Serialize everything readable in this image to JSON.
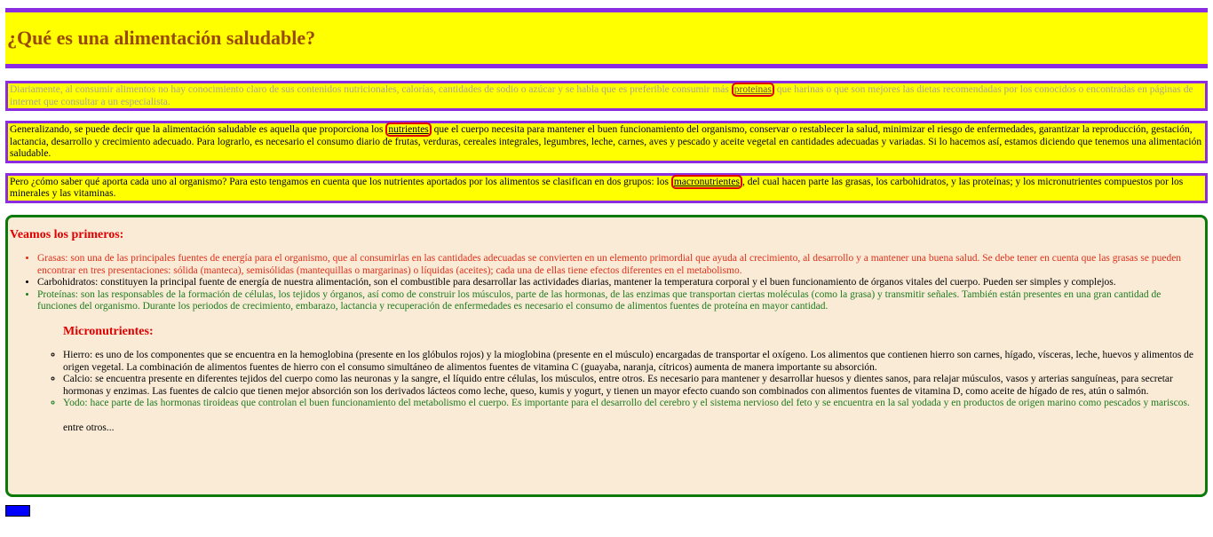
{
  "header": {
    "title": "¿Qué es una alimentación saludable?"
  },
  "paragraphs": {
    "p1": {
      "before": "Diariamente, al consumir alimentos no hay conocimiento claro de sus contenidos nutricionales, calorías, cantidades de sodio o azúcar y se habla que es preferible consumir más ",
      "link": "proteinas",
      "after": " que harinas o que son mejores las dietas recomendadas por los conocidos o encontradas en páginas de internet que consultar a un especialista."
    },
    "p2": {
      "before": "Generalizando, se puede decir que la alimentación saludable es aquella que proporciona los ",
      "link": "nutrientes",
      "after": " que el cuerpo necesita para mantener el buen funcionamiento del organismo, conservar o restablecer la salud, minimizar el riesgo de enfermedades, garantizar la reproducción, gestación, lactancia, desarrollo y crecimiento adecuado. Para lograrlo, es necesario el consumo diario de frutas, verduras, cereales integrales, legumbres, leche, carnes, aves y pescado y aceite vegetal en cantidades adecuadas y variadas. Si lo hacemos así, estamos diciendo que tenemos una alimentación saludable."
    },
    "p3": {
      "before": "Pero ¿cómo saber qué aporta cada uno al organismo? Para esto tengamos en cuenta que los nutrientes aportados por los alimentos se clasifican en dos grupos: los ",
      "link": "macronutrientes",
      "after": ", del cual hacen parte las grasas, los carbohidratos, y las proteínas; y los micronutrientes compuestos por los minerales y las vitaminas."
    }
  },
  "box": {
    "heading": "Veamos los primeros:",
    "macros": [
      "Grasas: son una de las principales fuentes de energía para el organismo, que al consumirlas en las cantidades adecuadas se convierten en un elemento primordial que ayuda al crecimiento, al desarrollo y a mantener una buena salud. Se debe tener en cuenta que las grasas se pueden encontrar en tres presentaciones: sólida (manteca), semisólidas (mantequillas o margarinas) o líquidas (aceites); cada una de ellas tiene efectos diferentes en el metabolismo.",
      "Carbohidratos: constituyen la principal fuente de energía de nuestra alimentación, son el combustible para desarrollar las actividades diarias, mantener la temperatura corporal y el buen funcionamiento de órganos vitales del cuerpo. Pueden ser simples y complejos.",
      "Proteínas: son las responsables de la formación de células, los tejidos y órganos, así como de construir los músculos, parte de las hormonas, de las enzimas que transportan ciertas moléculas (como la grasa) y transmitir señales. También están presentes en una gran cantidad de funciones del organismo. Durante los periodos de crecimiento, embarazo, lactancia y recuperación de enfermedades es necesario el consumo de alimentos fuentes de proteína en mayor cantidad."
    ],
    "micro_heading": "Micronutrientes:",
    "micros": [
      "Hierro: es uno de los componentes que se encuentra en la hemoglobina (presente en los glóbulos rojos) y la mioglobina (presente en el músculo) encargadas de transportar el oxígeno. Los alimentos que contienen hierro son carnes, hígado, vísceras, leche, huevos y alimentos de origen vegetal. La combinación de alimentos fuentes de hierro con el consumo simultáneo de alimentos fuentes de vitamina C (guayaba, naranja, cítricos) aumenta de manera importante su absorción.",
      "Calcio: se encuentra presente en diferentes tejidos del cuerpo como las neuronas y la sangre, el líquido entre células, los músculos, entre otros. Es necesario para mantener y desarrollar huesos y dientes sanos, para relajar músculos, vasos y arterias sanguíneas, para secretar hormonas y enzimas. Las fuentes de calcio que tienen mejor absorción son los derivados lácteos como leche, queso, kumis y yogurt, y tienen un mayor efecto cuando son combinados con alimentos fuentes de vitamina D, como aceite de hígado de res, atún o salmón.",
      "Yodo: hace parte de las hormonas tiroideas que controlan el buen funcionamiento del metabolismo el cuerpo. Es importante para el desarrollo del cerebro y el sistema nervioso del feto y se encuentra en la sal yodada y en productos de origen marino como pescados y mariscos."
    ],
    "footer": "entre otros..."
  },
  "colors": {
    "header_bg": "#ffff00",
    "border_purple": "#8b2be2",
    "title_brown": "#9a4a00",
    "box_border_green": "#0a7a0a",
    "box_bg": "#faebd7",
    "heading_red": "#e00000"
  },
  "button": {
    "label": ""
  }
}
